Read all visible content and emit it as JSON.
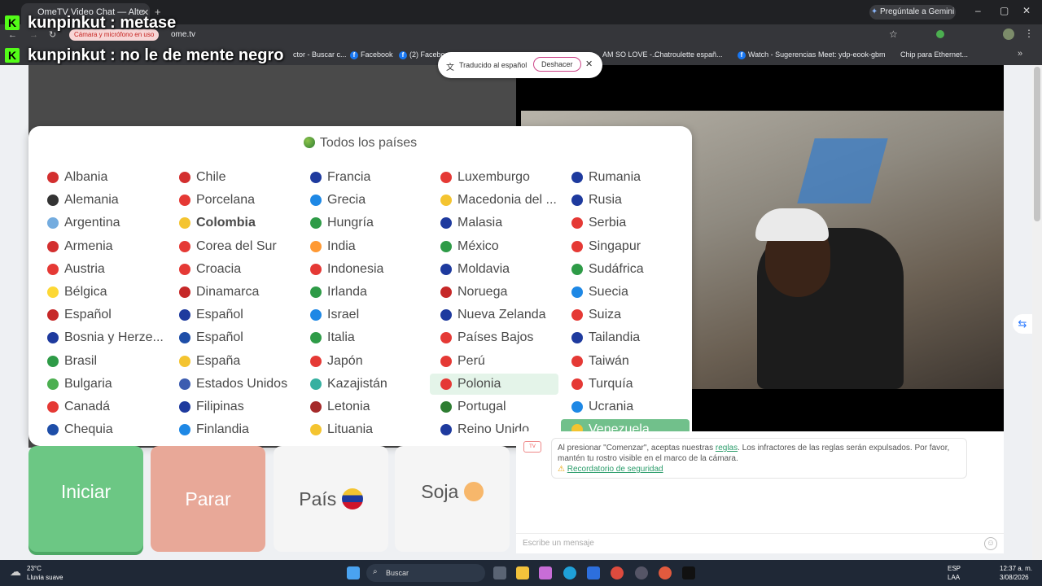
{
  "browser": {
    "tab_title": "OmeTV Video Chat — Alte",
    "gemini_button": "Pregúntale a Gemini",
    "camera_chip": "Cámara y micrófono en uso",
    "url": "ome.tv",
    "bookmarks": [
      {
        "label": "Facebook"
      },
      {
        "label": "(2) Faceboo"
      },
      {
        "label": "AM SO LOVE -..."
      },
      {
        "label": "Chatroulette españ..."
      },
      {
        "label": "Watch - Sugerencias"
      },
      {
        "label": "Meet: ydp-eook-gbm"
      },
      {
        "label": "Chip para Ethernet..."
      }
    ],
    "bookmark_partial": "ctor - Buscar c..."
  },
  "stream_overlay": {
    "line1_user": "kunpinkut",
    "line1_text": ": metase",
    "line2_user": "kunpinkut",
    "line2_text": ": no le de mente negro"
  },
  "translate_popup": {
    "label": "Traducido al español",
    "undo_button": "Deshacer"
  },
  "country_dropdown": {
    "title": "Todos los países",
    "columns": [
      [
        "Albania",
        "Alemania",
        "Argentina",
        "Armenia",
        "Austria",
        "Bélgica",
        "Español",
        "Bosnia y Herze...",
        "Brasil",
        "Bulgaria",
        "Canadá",
        "Chequia"
      ],
      [
        "Chile",
        "Porcelana",
        "Colombia",
        "Corea del Sur",
        "Croacia",
        "Dinamarca",
        "Español",
        "Español",
        "España",
        "Estados Unidos",
        "Filipinas",
        "Finlandia"
      ],
      [
        "Francia",
        "Grecia",
        "Hungría",
        "India",
        "Indonesia",
        "Irlanda",
        "Israel",
        "Italia",
        "Japón",
        "Kazajistán",
        "Letonia",
        "Lituania"
      ],
      [
        "Luxemburgo",
        "Macedonia del ...",
        "Malasia",
        "México",
        "Moldavia",
        "Noruega",
        "Nueva Zelanda",
        "Países Bajos",
        "Perú",
        "Polonia",
        "Portugal",
        "Reino Unido"
      ],
      [
        "Rumania",
        "Rusia",
        "Serbia",
        "Singapur",
        "Sudáfrica",
        "Suecia",
        "Suiza",
        "Tailandia",
        "Taiwán",
        "Turquía",
        "Ucrania",
        "Venezuela"
      ]
    ],
    "bold_item": "Colombia",
    "hovered_item": "Polonia",
    "selected_item": "Venezuela"
  },
  "controls": {
    "start": "Iniciar",
    "stop": "Parar",
    "country": "País",
    "gender": "Soja",
    "start_color": "#6cc784",
    "stop_color": "#e8a898"
  },
  "chat": {
    "rules_text_pre": "Al presionar \"Comenzar\", aceptas nuestras",
    "rules_link": "reglas",
    "rules_text_post": ". Los infractores de las reglas serán expulsados. Por favor, mantén tu rostro visible en el marco de la cámara.",
    "safety_link": "Recordatorio de seguridad",
    "input_placeholder": "Escribe un mensaje"
  },
  "taskbar": {
    "weather_temp": "23°C",
    "weather_desc": "Lluvia suave",
    "search_label": "Buscar",
    "lang1": "ESP",
    "lang2": "LAA",
    "time": "12:37 a. m.",
    "date": "3/08/2026"
  }
}
